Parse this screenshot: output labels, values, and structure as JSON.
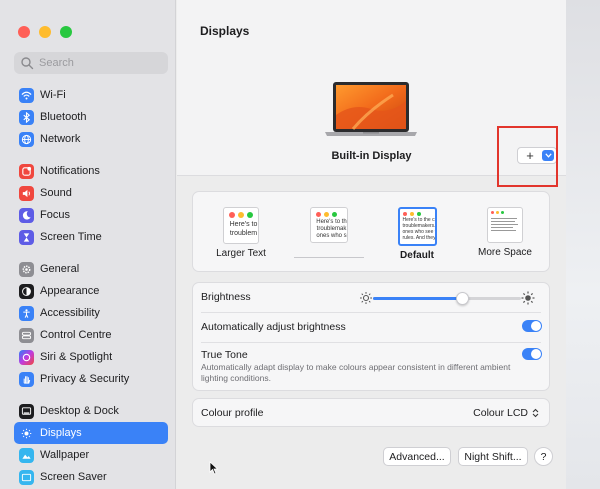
{
  "sidebar": {
    "search_placeholder": "Search",
    "items": [
      {
        "label": "Wi-Fi",
        "icon": "wifi-icon",
        "color": "#3a82f7"
      },
      {
        "label": "Bluetooth",
        "icon": "bluetooth-icon",
        "color": "#3a82f7"
      },
      {
        "label": "Network",
        "icon": "globe-icon",
        "color": "#3a82f7"
      },
      {
        "label": "Notifications",
        "icon": "notifications-icon",
        "color": "#f0473e"
      },
      {
        "label": "Sound",
        "icon": "speaker-icon",
        "color": "#f0473e"
      },
      {
        "label": "Focus",
        "icon": "moon-icon",
        "color": "#5e5ce6"
      },
      {
        "label": "Screen Time",
        "icon": "hourglass-icon",
        "color": "#5e5ce6"
      },
      {
        "label": "General",
        "icon": "gear-icon",
        "color": "#8e8e93"
      },
      {
        "label": "Appearance",
        "icon": "appearance-icon",
        "color": "#1d1d1f"
      },
      {
        "label": "Accessibility",
        "icon": "accessibility-icon",
        "color": "#3a82f7"
      },
      {
        "label": "Control Centre",
        "icon": "control-centre-icon",
        "color": "#8e8e93"
      },
      {
        "label": "Siri & Spotlight",
        "icon": "siri-icon",
        "color": "#c03be0"
      },
      {
        "label": "Privacy & Security",
        "icon": "hand-icon",
        "color": "#3a82f7"
      },
      {
        "label": "Desktop & Dock",
        "icon": "dock-icon",
        "color": "#1d1d1f"
      },
      {
        "label": "Displays",
        "icon": "sun-icon",
        "color": "#3a82f7"
      },
      {
        "label": "Wallpaper",
        "icon": "wallpaper-icon",
        "color": "#35b6ef"
      },
      {
        "label": "Screen Saver",
        "icon": "screensaver-icon",
        "color": "#35b6ef"
      }
    ]
  },
  "main": {
    "title": "Displays",
    "display_name": "Built-in Display",
    "add_button_label": "+",
    "resolution_options": [
      {
        "label": "Larger Text",
        "preview_text": "Here's to\ntroublem"
      },
      {
        "label": "",
        "preview_text": "Here's to th\ntroublemak\nones who s"
      },
      {
        "label": "Default",
        "preview_text": "Here's to the c\ntroublemakers.\nones who see t\nrules. And they"
      },
      {
        "label": "More Space",
        "preview_text": ""
      }
    ],
    "brightness_label": "Brightness",
    "brightness_level": 0.6,
    "auto_brightness_label": "Automatically adjust brightness",
    "true_tone_label": "True Tone",
    "true_tone_description": "Automatically adapt display to make colours appear consistent in different ambient lighting conditions.",
    "colour_profile_label": "Colour profile",
    "colour_profile_value": "Colour LCD",
    "advanced_button": "Advanced...",
    "night_shift_button": "Night Shift...",
    "help_button": "?"
  },
  "colors": {
    "accent": "#3a82f7",
    "highlight": "#e2352c"
  }
}
